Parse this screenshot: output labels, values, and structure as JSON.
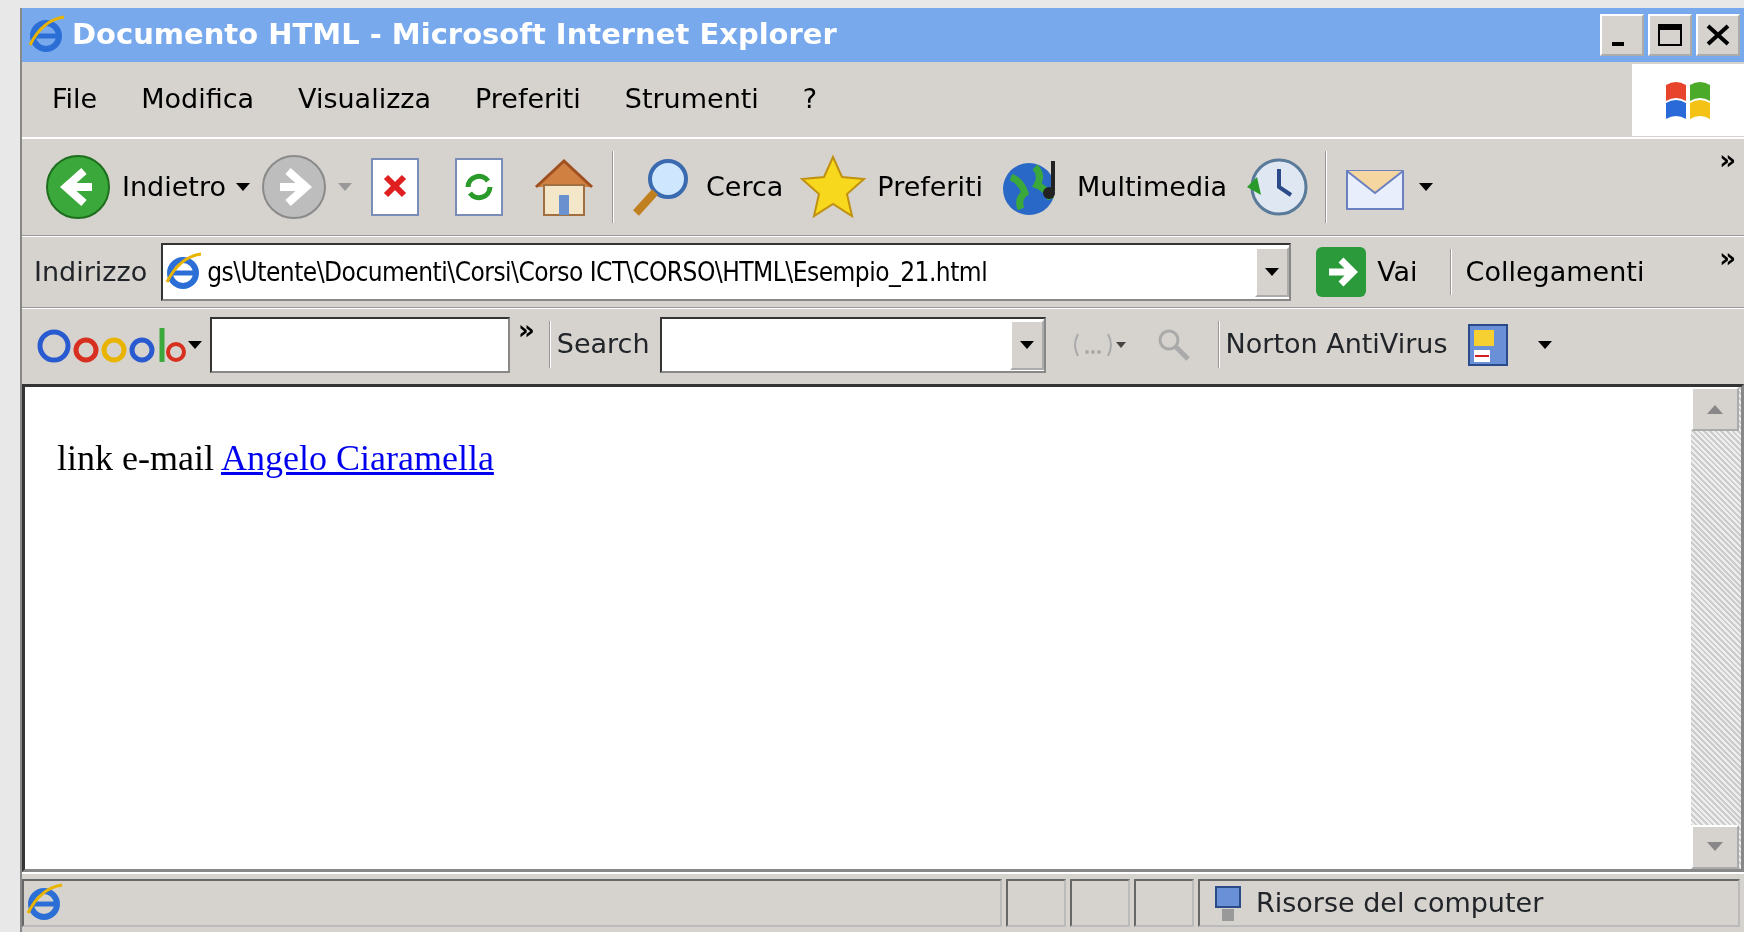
{
  "window": {
    "title": "Documento HTML - Microsoft Internet Explorer"
  },
  "menu": [
    "File",
    "Modifica",
    "Visualizza",
    "Preferiti",
    "Strumenti",
    "?"
  ],
  "toolbar": {
    "items": [
      {
        "kind": "back",
        "label": "Indietro"
      },
      {
        "kind": "forward"
      },
      {
        "kind": "stop"
      },
      {
        "kind": "refresh"
      },
      {
        "kind": "home"
      },
      {
        "kind": "search",
        "label": "Cerca"
      },
      {
        "kind": "favorites",
        "label": "Preferiti"
      },
      {
        "kind": "media",
        "label": "Multimedia"
      },
      {
        "kind": "history"
      },
      {
        "kind": "mail"
      }
    ],
    "chevron": "»"
  },
  "address_bar": {
    "label": "Indirizzo",
    "value": "gs\\Utente\\Documenti\\Corsi\\Corso ICT\\CORSO\\HTML\\Esempio_21.html",
    "go": "Vai",
    "links": "Collegamenti",
    "chevron": "»"
  },
  "google_bar": {
    "chevron": "»",
    "search_label": "Search",
    "norton": "Norton AntiVirus"
  },
  "page": {
    "text": "link e-mail",
    "link": "Angelo Ciaramella"
  },
  "status_bar": {
    "zone": "Risorse del computer"
  }
}
